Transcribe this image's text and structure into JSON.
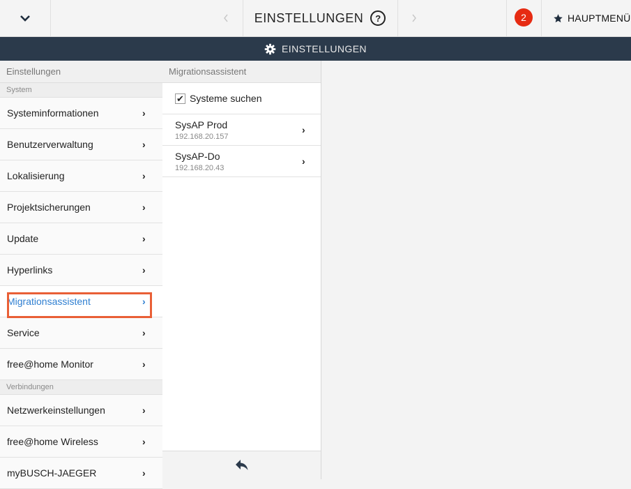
{
  "topbar": {
    "title": "EINSTELLUNGEN",
    "help_icon": "?",
    "badge_count": "2",
    "main_menu_label": "HAUPTMENÜ"
  },
  "section": {
    "title": "EINSTELLUNGEN",
    "icon": "gear-icon"
  },
  "left": {
    "header": "Einstellungen",
    "groups": [
      {
        "label": "System",
        "items": [
          {
            "label": "Systeminformationen"
          },
          {
            "label": "Benutzerverwaltung"
          },
          {
            "label": "Lokalisierung"
          },
          {
            "label": "Projektsicherungen"
          },
          {
            "label": "Update"
          },
          {
            "label": "Hyperlinks"
          },
          {
            "label": "Migrationsassistent",
            "active": true
          },
          {
            "label": "Service"
          },
          {
            "label": "free@home Monitor"
          }
        ]
      },
      {
        "label": "Verbindungen",
        "items": [
          {
            "label": "Netzwerkeinstellungen"
          },
          {
            "label": "free@home Wireless"
          },
          {
            "label": "myBUSCH-JAEGER"
          }
        ]
      }
    ]
  },
  "middle": {
    "header": "Migrationsassistent",
    "search_checkbox": {
      "label": "Systeme suchen",
      "checked": true
    },
    "systems": [
      {
        "name": "SysAP Prod",
        "ip": "192.168.20.157"
      },
      {
        "name": "SysAP-Do",
        "ip": "192.168.20.43"
      }
    ]
  },
  "colors": {
    "accent": "#2f7fd1",
    "bar": "#2b3a4b",
    "badge": "#e62b12",
    "highlight": "#e95f36"
  }
}
